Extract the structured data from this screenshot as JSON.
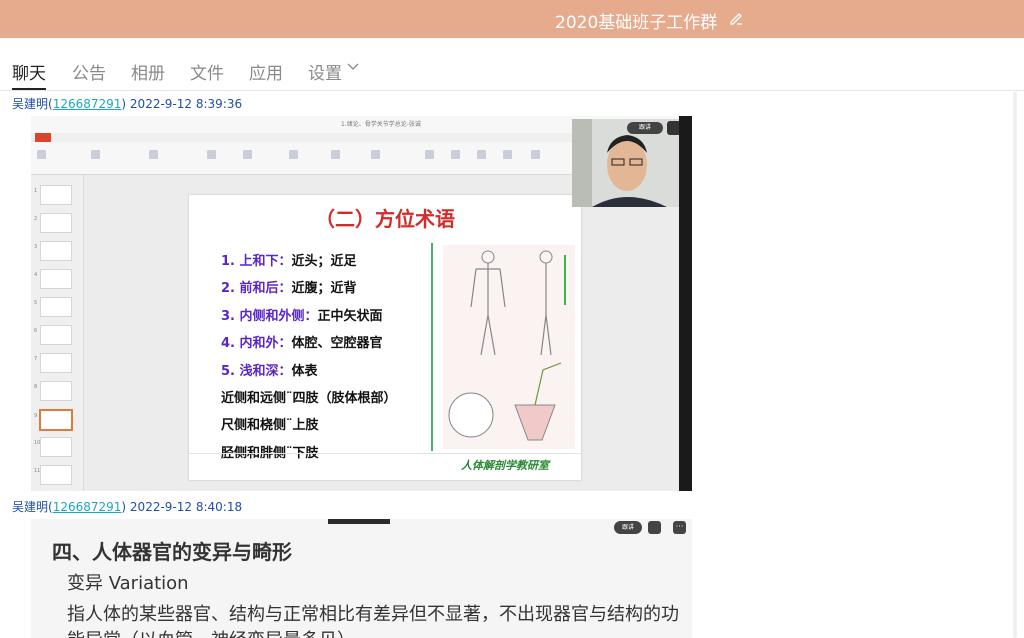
{
  "window": {
    "title": "2020基础班子工作群"
  },
  "tabs": [
    "聊天",
    "公告",
    "相册",
    "文件",
    "应用",
    "设置"
  ],
  "messages": [
    {
      "sender": "吴建明",
      "qq": "126687291",
      "time": "2022-9-12 8:39:36"
    },
    {
      "sender": "吴建明",
      "qq": "126687291",
      "time": "2022-9-12 8:40:18"
    }
  ],
  "slide1": {
    "doc_title": "1.绪论、骨学关节学总论-张诚",
    "title": "（二）方位术语",
    "items": [
      {
        "key": "1. 上和下：",
        "val": "近头；近足"
      },
      {
        "key": "2. 前和后：",
        "val": "近腹；近背"
      },
      {
        "key": "3. 内侧和外侧：",
        "val": "正中矢状面"
      },
      {
        "key": "4. 内和外：",
        "val": "体腔、空腔器官"
      },
      {
        "key": "5. 浅和深：",
        "val": "体表"
      },
      {
        "key": "",
        "val": "近侧和远侧¨四肢（肢体根部）"
      },
      {
        "key": "",
        "val": "尺侧和桡侧¨上肢"
      },
      {
        "key": "",
        "val": "胫侧和腓侧¨下肢"
      }
    ],
    "footer": "人体解剖学教研室",
    "cam_button": "跟讲"
  },
  "slide2": {
    "heading": "四、人体器官的变异与畸形",
    "subheading": "变异 Variation",
    "body": "指人体的某些器官、结构与正常相比有差异但不显著，不出现器官与结构的功能异常（以血管、神经变异最多见）",
    "cam_button": "跟讲",
    "more": "···"
  },
  "colors": {
    "titlebar": "#e6aa8c",
    "link": "#1aa7c9",
    "meta": "#1f4ea8",
    "slide_title": "#d32a2a",
    "slide_key": "#5a26c8"
  }
}
